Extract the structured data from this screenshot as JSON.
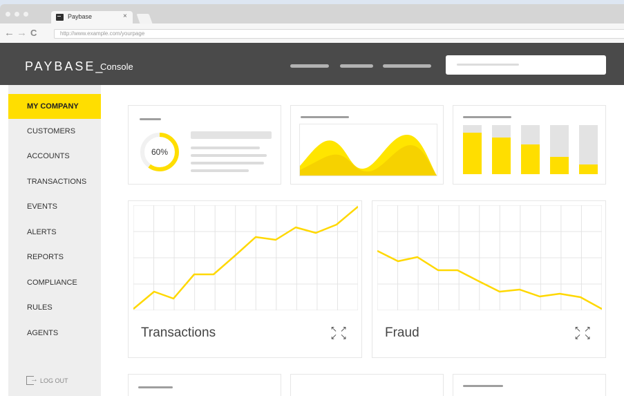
{
  "browser": {
    "tab_title": "Paybase",
    "tab_close": "×",
    "url": "http://www.example.com/yourpage",
    "back_icon": "←",
    "forward_icon": "→",
    "reload_icon": "C"
  },
  "header": {
    "brand": "PAYBASE_",
    "subtitle": "Console"
  },
  "sidebar": {
    "items": [
      {
        "label": "MY COMPANY",
        "active": true
      },
      {
        "label": "CUSTOMERS"
      },
      {
        "label": "ACCOUNTS"
      },
      {
        "label": "TRANSACTIONS"
      },
      {
        "label": "EVENTS"
      },
      {
        "label": "ALERTS"
      },
      {
        "label": "REPORTS"
      },
      {
        "label": "COMPLIANCE"
      },
      {
        "label": "RULES"
      },
      {
        "label": "AGENTS"
      }
    ],
    "logout": "LOG OUT"
  },
  "widgets": {
    "donut": {
      "label": "60%",
      "progress": 0.6
    },
    "bars": [
      0.85,
      0.75,
      0.6,
      0.35,
      0.2
    ]
  },
  "charts": {
    "transactions": {
      "title": "Transactions"
    },
    "fraud": {
      "title": "Fraud"
    }
  },
  "colors": {
    "accent": "#ffde00",
    "header": "#4a4a4a",
    "sidebar": "#eeeeee"
  }
}
